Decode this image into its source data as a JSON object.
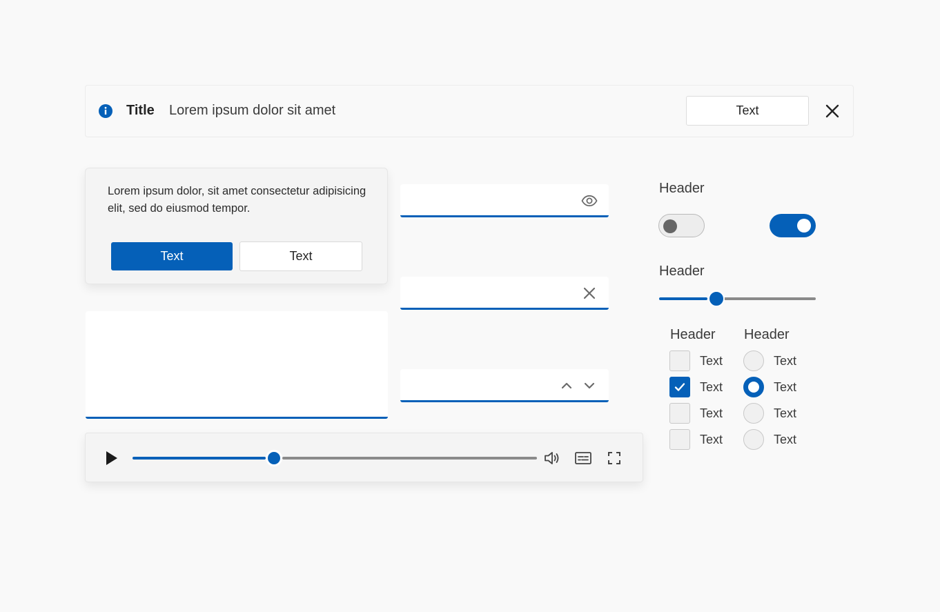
{
  "infobar": {
    "title": "Title",
    "message": "Lorem ipsum dolor sit amet",
    "action_label": "Text",
    "icon": "info-icon",
    "close_icon": "close-icon"
  },
  "dialog": {
    "body": "Lorem ipsum dolor, sit amet consectetur adipisicing elit, sed do eiusmod tempor.",
    "primary_label": "Text",
    "secondary_label": "Text"
  },
  "inputs": {
    "password": {
      "value": "",
      "placeholder": "",
      "icon": "eye-icon"
    },
    "search": {
      "value": "",
      "placeholder": "",
      "icon": "clear-icon"
    },
    "number": {
      "value": "",
      "placeholder": "",
      "icons": [
        "chevron-up-icon",
        "chevron-down-icon"
      ]
    },
    "textarea": {
      "value": "",
      "placeholder": ""
    }
  },
  "toggles": {
    "header": "Header",
    "items": [
      {
        "state": "off"
      },
      {
        "state": "on"
      }
    ]
  },
  "slider": {
    "header": "Header",
    "value": 0.36
  },
  "checkboxes": {
    "header": "Header",
    "items": [
      {
        "label": "Text",
        "checked": false
      },
      {
        "label": "Text",
        "checked": true
      },
      {
        "label": "Text",
        "checked": false
      },
      {
        "label": "Text",
        "checked": false
      }
    ]
  },
  "radios": {
    "header": "Header",
    "items": [
      {
        "label": "Text",
        "checked": false
      },
      {
        "label": "Text",
        "checked": true
      },
      {
        "label": "Text",
        "checked": false
      },
      {
        "label": "Text",
        "checked": false
      }
    ]
  },
  "player": {
    "progress": 0.35,
    "icons": [
      "play-icon",
      "volume-icon",
      "captions-icon",
      "fullscreen-icon"
    ]
  },
  "colors": {
    "accent": "#0560b8",
    "background": "#f9f9f9",
    "track": "#8a8a8a"
  }
}
